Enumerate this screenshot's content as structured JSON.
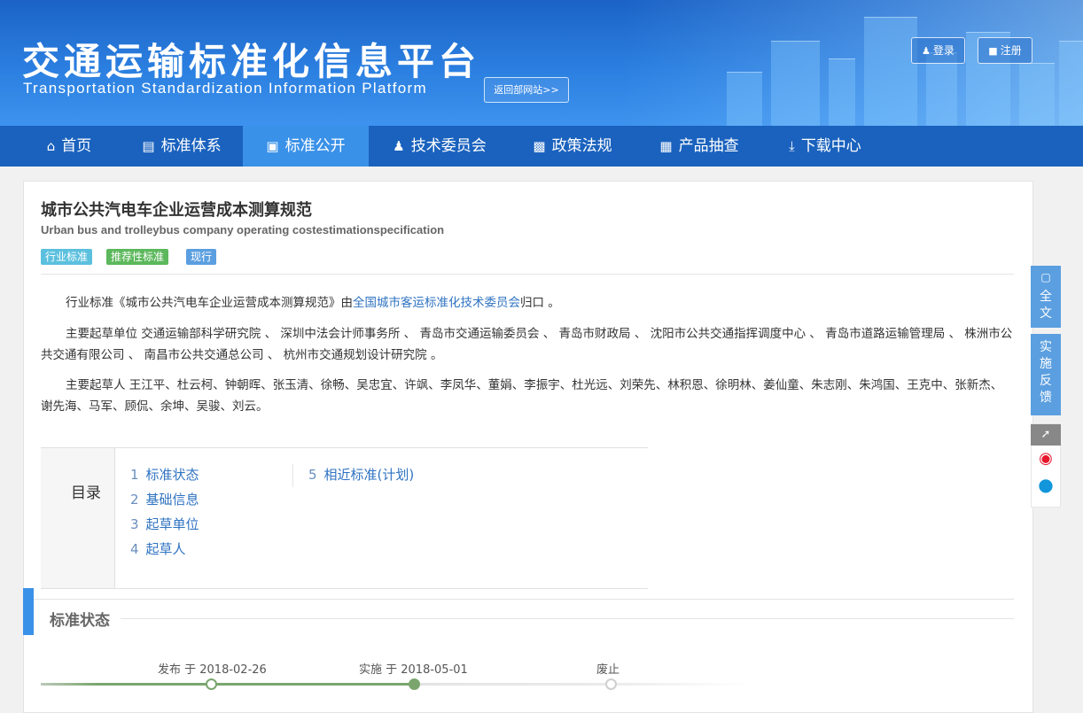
{
  "header": {
    "title_cn": "交通运输标准化信息平台",
    "title_en": "Transportation Standardization Information Platform",
    "back_link": "返回部网站>>",
    "login": "登录",
    "register": "注册"
  },
  "nav": {
    "items": [
      {
        "label": "首页",
        "icon": "home-icon"
      },
      {
        "label": "标准体系",
        "icon": "list-icon"
      },
      {
        "label": "标准公开",
        "icon": "book-icon",
        "active": true
      },
      {
        "label": "技术委员会",
        "icon": "user-icon"
      },
      {
        "label": "政策法规",
        "icon": "inbox-icon"
      },
      {
        "label": "产品抽查",
        "icon": "screen-icon"
      },
      {
        "label": "下载中心",
        "icon": "download-icon"
      }
    ]
  },
  "standard": {
    "title": "城市公共汽电车企业运营成本测算规范",
    "title_en": "Urban bus and trolleybus company operating costestimationspecification",
    "tags": [
      "行业标准",
      "推荐性标准",
      "现行"
    ],
    "intro_prefix": "行业标准《城市公共汽电车企业运营成本测算规范》由",
    "intro_link": "全国城市客运标准化技术委员会",
    "intro_suffix": "归口 。",
    "drafting_units": "主要起草单位 交通运输部科学研究院 、 深圳中法会计师事务所 、 青岛市交通运输委员会 、 青岛市财政局 、 沈阳市公共交通指挥调度中心 、 青岛市道路运输管理局 、 株洲市公共交通有限公司 、 南昌市公共交通总公司 、 杭州市交通规划设计研究院 。",
    "drafters": "主要起草人 王江平、杜云柯、钟朝晖、张玉清、徐畅、吴忠宜、许飒、李凤华、董娟、李振宇、杜光远、刘荣先、林积恩、徐明林、姜仙童、朱志刚、朱鸿国、王克中、张新杰、谢先海、马军、顾侃、余坤、吴骏、刘云。"
  },
  "toc": {
    "label": "目录",
    "items": [
      {
        "num": "1",
        "label": "标准状态"
      },
      {
        "num": "2",
        "label": "基础信息"
      },
      {
        "num": "3",
        "label": "起草单位"
      },
      {
        "num": "4",
        "label": "起草人"
      },
      {
        "num": "5",
        "label": "相近标准(计划)"
      }
    ]
  },
  "section": {
    "title": "标准状态"
  },
  "timeline": [
    {
      "label": "发布 于 2018-02-26",
      "state": "done"
    },
    {
      "label": "实施 于 2018-05-01",
      "state": "current"
    },
    {
      "label": "废止",
      "state": "pending"
    }
  ],
  "side": {
    "fulltext": "全文",
    "feedback": "实施反馈"
  },
  "colors": {
    "primary": "#1a62be",
    "active_nav": "#3a91e8",
    "tag_industry": "#5bc0de",
    "tag_recommended": "#5cb85c",
    "tag_current": "#5b9fe0",
    "timeline_green": "#7aa66e"
  }
}
